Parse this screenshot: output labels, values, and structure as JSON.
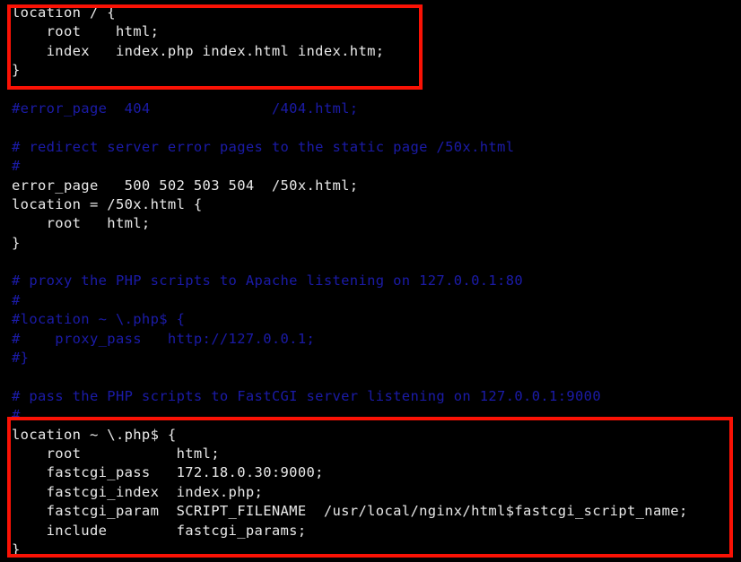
{
  "window": {
    "type": "terminal",
    "background_color": "#000000",
    "text_color": "#e9e9e9",
    "comment_color": "#1b1ba8",
    "highlight_color": "#fa1205",
    "file_description": "nginx.conf server block"
  },
  "editor": {
    "lines": [
      {
        "n": 1,
        "text": "location / {",
        "kind": "code"
      },
      {
        "n": 2,
        "text": "    root    html;",
        "kind": "code"
      },
      {
        "n": 3,
        "text": "    index   index.php index.html index.htm;",
        "kind": "code"
      },
      {
        "n": 4,
        "text": "}",
        "kind": "code"
      },
      {
        "n": 5,
        "text": "",
        "kind": "blank"
      },
      {
        "n": 6,
        "text": "#error_page  404              /404.html;",
        "kind": "cmt"
      },
      {
        "n": 7,
        "text": "",
        "kind": "blank"
      },
      {
        "n": 8,
        "text": "# redirect server error pages to the static page /50x.html",
        "kind": "cmt"
      },
      {
        "n": 9,
        "text": "#",
        "kind": "cmt"
      },
      {
        "n": 10,
        "text": "error_page   500 502 503 504  /50x.html;",
        "kind": "code"
      },
      {
        "n": 11,
        "text": "location = /50x.html {",
        "kind": "code"
      },
      {
        "n": 12,
        "text": "    root   html;",
        "kind": "code"
      },
      {
        "n": 13,
        "text": "}",
        "kind": "code"
      },
      {
        "n": 14,
        "text": "",
        "kind": "blank"
      },
      {
        "n": 15,
        "text": "# proxy the PHP scripts to Apache listening on 127.0.0.1:80",
        "kind": "cmt"
      },
      {
        "n": 16,
        "text": "#",
        "kind": "cmt"
      },
      {
        "n": 17,
        "text": "#location ~ \\.php$ {",
        "kind": "cmt"
      },
      {
        "n": 18,
        "text": "#    proxy_pass   http://127.0.0.1;",
        "kind": "cmt"
      },
      {
        "n": 19,
        "text": "#}",
        "kind": "cmt"
      },
      {
        "n": 20,
        "text": "",
        "kind": "blank"
      },
      {
        "n": 21,
        "text": "# pass the PHP scripts to FastCGI server listening on 127.0.0.1:9000",
        "kind": "cmt"
      },
      {
        "n": 22,
        "text": "#",
        "kind": "cmt"
      },
      {
        "n": 23,
        "text": "location ~ \\.php$ {",
        "kind": "code"
      },
      {
        "n": 24,
        "text": "    root           html;",
        "kind": "code"
      },
      {
        "n": 25,
        "text": "    fastcgi_pass   172.18.0.30:9000;",
        "kind": "code"
      },
      {
        "n": 26,
        "text": "    fastcgi_index  index.php;",
        "kind": "code"
      },
      {
        "n": 27,
        "text": "    fastcgi_param  SCRIPT_FILENAME  /usr/local/nginx/html$fastcgi_script_name;",
        "kind": "code"
      },
      {
        "n": 28,
        "text": "    include        fastcgi_params;",
        "kind": "code"
      },
      {
        "n": 29,
        "text": "}",
        "kind": "code"
      }
    ]
  },
  "annotations": {
    "boxes": [
      {
        "id": "location-root-block",
        "label": "location / block",
        "color": "#fa1205",
        "first_line": 1,
        "last_line": 4
      },
      {
        "id": "location-php-block",
        "label": "location ~ \\.php$ block",
        "color": "#fa1205",
        "first_line": 23,
        "last_line": 29
      }
    ]
  }
}
